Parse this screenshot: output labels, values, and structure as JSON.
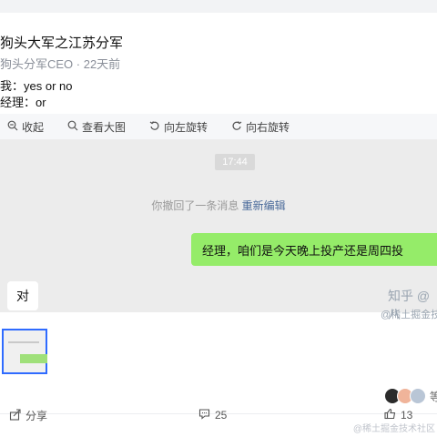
{
  "post": {
    "title": "狗头大军之江苏分军",
    "meta": "狗头分军CEO · 22天前",
    "line1": "我：yes or no",
    "line2": "经理：or"
  },
  "toolbar": {
    "collapse": "收起",
    "view_large": "查看大图",
    "rotate_left": "向左旋转",
    "rotate_right": "向右旋转"
  },
  "chat": {
    "time": "17:44",
    "recall_text": "你撤回了一条消息",
    "recall_link": "重新编辑",
    "green_message": "经理，咱们是今天晚上投产还是周四投",
    "white_message": "对",
    "watermark_1": "知乎 @八",
    "watermark_2": "@稀土掘金技"
  },
  "reactions": {
    "more": "等"
  },
  "footer": {
    "share": "分享",
    "comments": "25",
    "likes": "13",
    "corner_watermark": "@稀土掘金技术社区"
  },
  "colors": {
    "green_bubble": "#95ec69",
    "thumb_border": "#2f6bff",
    "link": "#4a6a9a"
  }
}
